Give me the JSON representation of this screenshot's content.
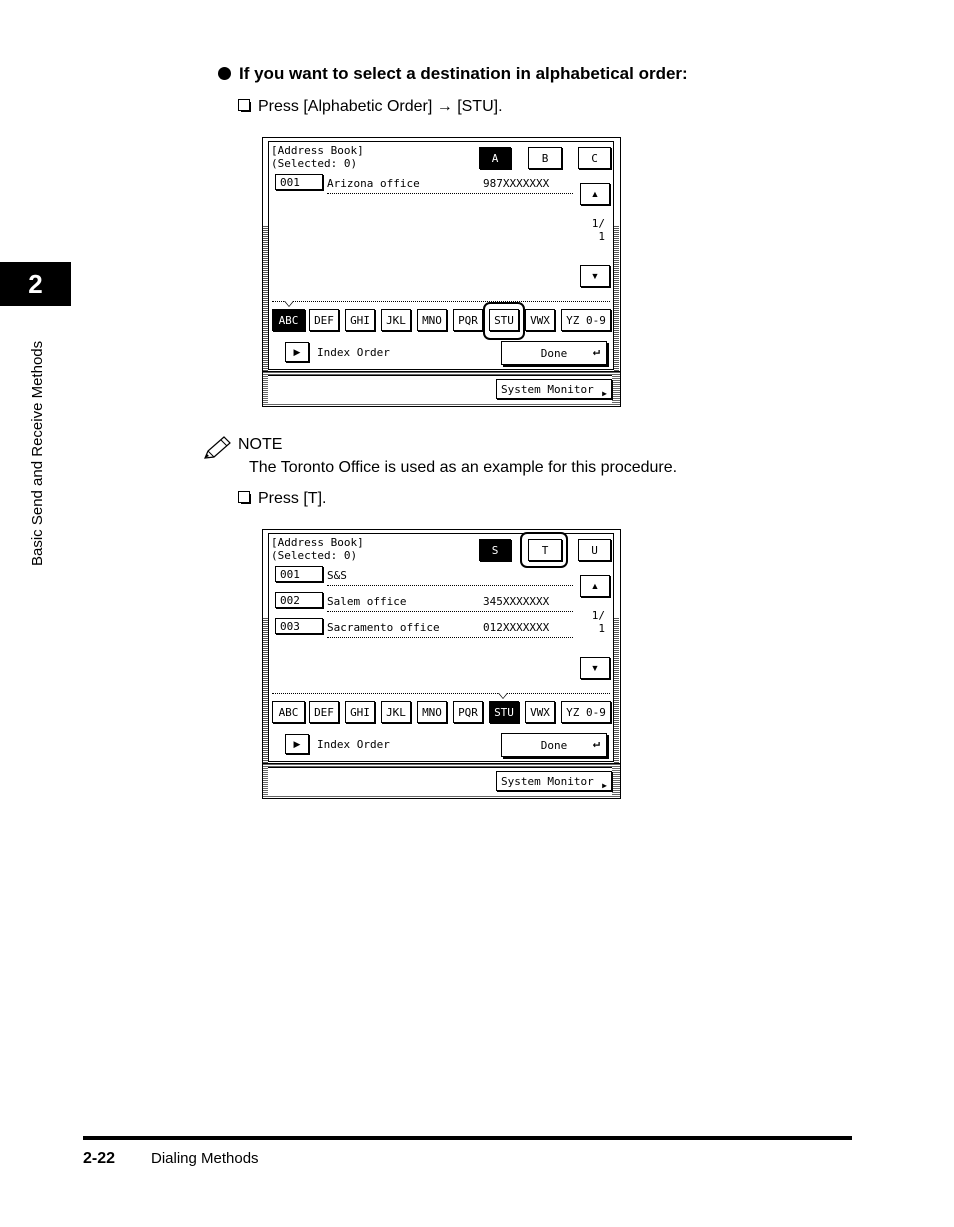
{
  "chapter_tab": "2",
  "side_label": "Basic Send and Receive Methods",
  "heading": "If you want to select a destination in alphabetical order:",
  "step1": "Press [Alphabetic Order] → [STU].",
  "note": {
    "title": "NOTE",
    "body": "The Toronto Office is used as an example for this procedure."
  },
  "step2": "Press [T].",
  "screen1": {
    "header": "[Address Book]\n(Selected: 0)",
    "letters": [
      "A",
      "B",
      "C"
    ],
    "letter_selected": 0,
    "entries": [
      {
        "num": "001",
        "name": "Arizona office",
        "phone": "987XXXXXXX"
      }
    ],
    "page_top": "1/",
    "page_bottom": "1",
    "groups": [
      "ABC",
      "DEF",
      "GHI",
      "JKL",
      "MNO",
      "PQR",
      "STU",
      "VWX",
      "YZ 0-9"
    ],
    "group_selected": 0,
    "index_order": "Index Order",
    "done": "Done",
    "system_monitor": "System Monitor",
    "icons": [
      "scroll-up-icon",
      "scroll-down-icon",
      "enter-icon",
      "play-triangle-icon"
    ]
  },
  "screen2": {
    "header": "[Address Book]\n(Selected: 0)",
    "letters": [
      "S",
      "T",
      "U"
    ],
    "letter_selected": 0,
    "entries": [
      {
        "num": "001",
        "name": "S&S",
        "phone": ""
      },
      {
        "num": "002",
        "name": "Salem office",
        "phone": "345XXXXXXX"
      },
      {
        "num": "003",
        "name": "Sacramento office",
        "phone": "012XXXXXXX"
      }
    ],
    "page_top": "1/",
    "page_bottom": "1",
    "groups": [
      "ABC",
      "DEF",
      "GHI",
      "JKL",
      "MNO",
      "PQR",
      "STU",
      "VWX",
      "YZ 0-9"
    ],
    "group_selected": 6,
    "index_order": "Index Order",
    "done": "Done",
    "system_monitor": "System Monitor"
  },
  "footer": {
    "page_number": "2-22",
    "section": "Dialing Methods"
  }
}
